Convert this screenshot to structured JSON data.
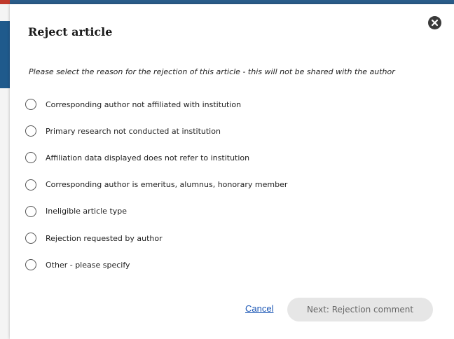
{
  "dialog": {
    "title": "Reject article",
    "instruction": "Please select the reason for the rejection of this article - this will not be shared with the author",
    "options": [
      {
        "label": "Corresponding author not affiliated with institution",
        "selected": false
      },
      {
        "label": "Primary research not conducted at institution",
        "selected": false
      },
      {
        "label": "Affiliation data displayed does not refer to institution",
        "selected": false
      },
      {
        "label": "Corresponding author is emeritus, alumnus, honorary member",
        "selected": false
      },
      {
        "label": "Ineligible article type",
        "selected": false
      },
      {
        "label": "Rejection requested by author",
        "selected": false
      },
      {
        "label": "Other - please specify",
        "selected": false
      }
    ],
    "cancel_label": "Cancel",
    "next_label": "Next: Rejection comment",
    "close_icon": "close-icon"
  },
  "colors": {
    "link": "#1a56b5",
    "disabled_button_bg": "#e6e6e6",
    "disabled_button_text": "#666666",
    "close_bg": "#3a3a3a"
  }
}
